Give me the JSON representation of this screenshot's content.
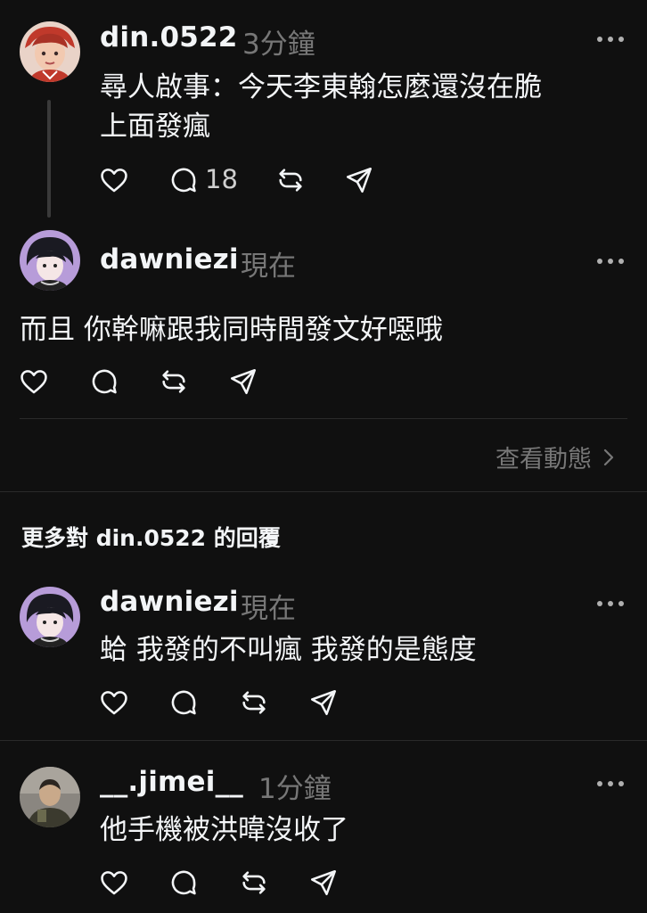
{
  "colors": {
    "background": "#101010",
    "text": "#f3f5f7",
    "muted": "#777777",
    "divider": "#2a2a2a"
  },
  "posts": [
    {
      "username": "din.0522",
      "time": "3分鐘",
      "text_line1": "尋人啟事：今天李東翰怎麼還沒在脆",
      "text_line2": "上面發瘋",
      "reply_count": "18"
    },
    {
      "username": "dawniezi",
      "time": "現在",
      "text": "而且 你幹嘛跟我同時間發文好噁哦"
    }
  ],
  "view_activity": "查看動態",
  "section_title": "更多對 din.0522 的回覆",
  "replies": [
    {
      "username": "dawniezi",
      "time": "現在",
      "text": "蛤 我發的不叫瘋 我發的是態度"
    },
    {
      "username": "__.jimei__",
      "time": "1分鐘",
      "text": "他手機被洪暐沒收了"
    }
  ],
  "icons": [
    "heart-icon",
    "comment-icon",
    "repost-icon",
    "share-icon",
    "more-icon",
    "chevron-right-icon"
  ]
}
